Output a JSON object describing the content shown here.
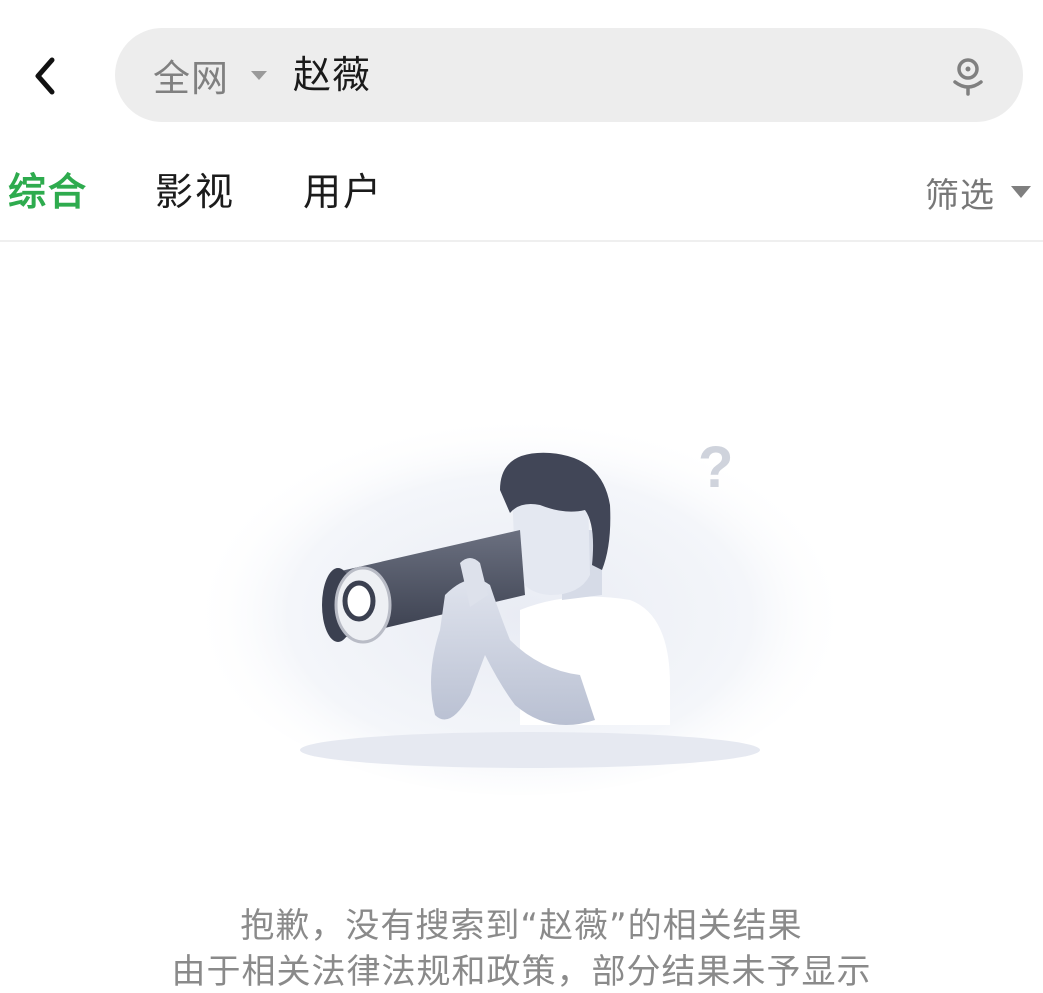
{
  "header": {
    "back_icon": "chevron-left-icon",
    "search": {
      "scope_label": "全网",
      "query": "赵薇",
      "voice_icon": "voice-search-icon"
    }
  },
  "tabs": [
    {
      "label": "综合",
      "active": true
    },
    {
      "label": "影视",
      "active": false
    },
    {
      "label": "用户",
      "active": false
    }
  ],
  "filter": {
    "label": "筛选"
  },
  "empty_state": {
    "illustration": "person-with-telescope",
    "question_mark": "?",
    "message_line1": "抱歉，没有搜索到“赵薇”的相关结果",
    "message_line2": "由于相关法律法规和政策，部分结果未予显示"
  },
  "colors": {
    "accent": "#2eab4e",
    "search_bg": "#ededed",
    "text_secondary": "#8a8a8a"
  }
}
